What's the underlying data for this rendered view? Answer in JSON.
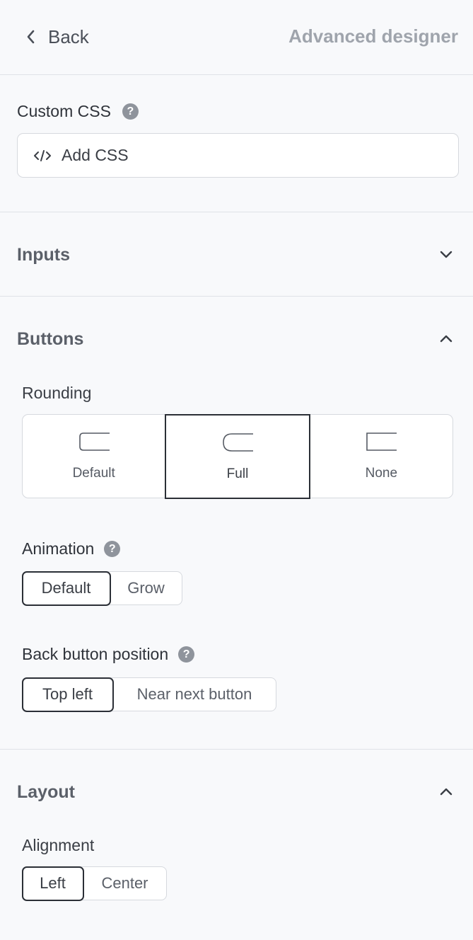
{
  "header": {
    "back_label": "Back",
    "title": "Advanced designer"
  },
  "custom_css": {
    "label": "Custom CSS",
    "help": "?",
    "add_label": "Add CSS",
    "add_icon": "code-icon"
  },
  "sections": {
    "inputs": {
      "title": "Inputs",
      "expanded": false
    },
    "buttons": {
      "title": "Buttons",
      "expanded": true,
      "rounding": {
        "label": "Rounding",
        "options": [
          "Default",
          "Full",
          "None"
        ],
        "selected": "Full"
      },
      "animation": {
        "label": "Animation",
        "help": "?",
        "options": [
          "Default",
          "Grow"
        ],
        "selected": "Default"
      },
      "back_button_position": {
        "label": "Back button position",
        "help": "?",
        "options": [
          "Top left",
          "Near next button"
        ],
        "selected": "Top left"
      }
    },
    "layout": {
      "title": "Layout",
      "expanded": true,
      "alignment": {
        "label": "Alignment",
        "options": [
          "Left",
          "Center"
        ],
        "selected": "Left"
      }
    }
  },
  "colors": {
    "background": "#f8f9fb",
    "border": "#d6d9de",
    "selected_border": "#2b2f36",
    "muted_text": "#9fa4ac"
  }
}
